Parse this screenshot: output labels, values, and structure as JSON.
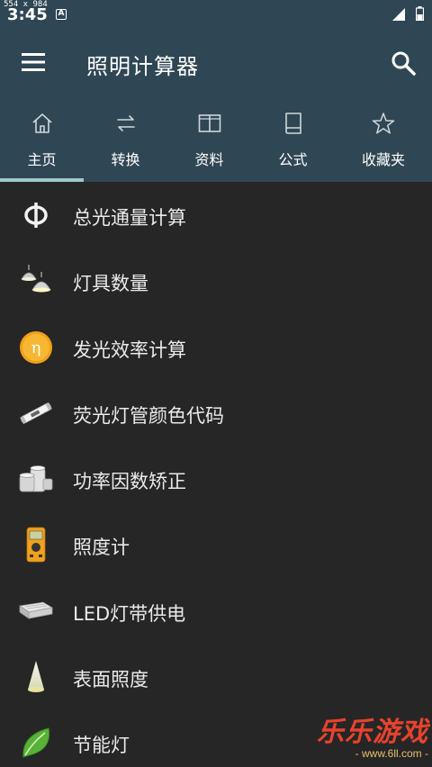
{
  "screen_size_label": "554 x 984",
  "status_bar": {
    "time": "3:45",
    "notification_icon": "A"
  },
  "app_bar": {
    "title": "照明计算器",
    "menu_icon": "menu-icon",
    "search_icon": "search-icon"
  },
  "tabs": [
    {
      "label": "主页",
      "icon": "home-icon",
      "selected": true
    },
    {
      "label": "转换",
      "icon": "convert-icon",
      "selected": false
    },
    {
      "label": "资料",
      "icon": "book-open-icon",
      "selected": false
    },
    {
      "label": "公式",
      "icon": "book-icon",
      "selected": false
    },
    {
      "label": "收藏夹",
      "icon": "star-icon",
      "selected": false
    }
  ],
  "items": [
    {
      "label": "总光通量计算",
      "icon": "phi-icon"
    },
    {
      "label": "灯具数量",
      "icon": "lamp-fixture-icon"
    },
    {
      "label": "发光效率计算",
      "icon": "eta-icon"
    },
    {
      "label": "荧光灯管颜色代码",
      "icon": "fluorescent-tube-icon"
    },
    {
      "label": "功率因数矫正",
      "icon": "capacitor-icon"
    },
    {
      "label": "照度计",
      "icon": "lux-meter-icon"
    },
    {
      "label": "LED灯带供电",
      "icon": "led-driver-icon"
    },
    {
      "label": "表面照度",
      "icon": "light-cone-icon"
    },
    {
      "label": "节能灯",
      "icon": "leaf-icon"
    }
  ],
  "watermark": {
    "title": "乐乐游戏",
    "url": "- www.6ll.com -"
  },
  "colors": {
    "app_bar": "#2f4654",
    "background": "#262626",
    "tab_indicator": "#9ec9c9",
    "eta_badge": "#f2a017",
    "leaf": "#59b238",
    "watermark": "#e8432d"
  }
}
